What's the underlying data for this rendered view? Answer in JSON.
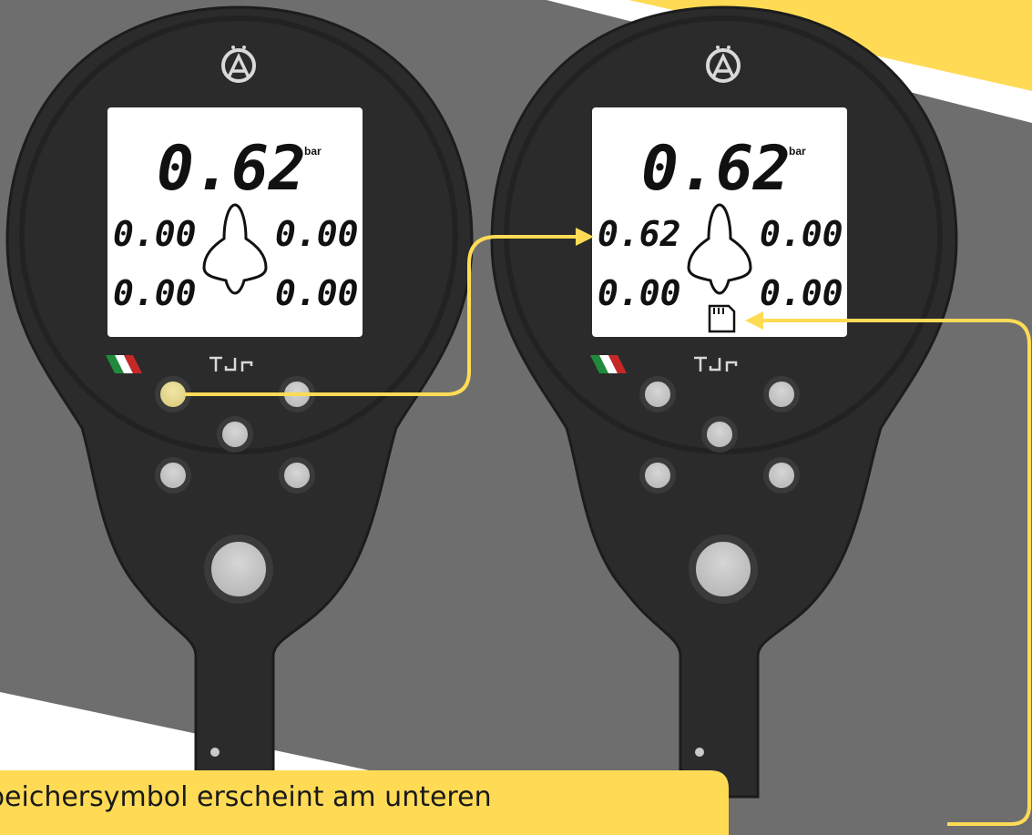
{
  "colors": {
    "accent": "#FFDB55",
    "background_dark": "#6e6e6e",
    "device_body": "#2b2b2b",
    "lcd": "#ffffff",
    "button": "#c9c9c9",
    "button_pressed": "#e9dd99"
  },
  "devices": [
    {
      "logo_icon": "brand-logo-a-icon",
      "unit": "bar",
      "main_value": "0.62",
      "tires": {
        "front_left": "0.00",
        "front_right": "0.00",
        "rear_left": "0.00",
        "rear_right": "0.00"
      },
      "memory_icon_visible": false,
      "pressed_button": "upper-left"
    },
    {
      "logo_icon": "brand-logo-a-icon",
      "unit": "bar",
      "main_value": "0.62",
      "tires": {
        "front_left": "0.62",
        "front_right": "0.00",
        "rear_left": "0.00",
        "rear_right": "0.00"
      },
      "memory_icon_visible": true,
      "memory_icon": "sd-card-icon",
      "pressed_button": null
    }
  ],
  "caption": {
    "text": "peichersymbol erscheint am unteren"
  }
}
